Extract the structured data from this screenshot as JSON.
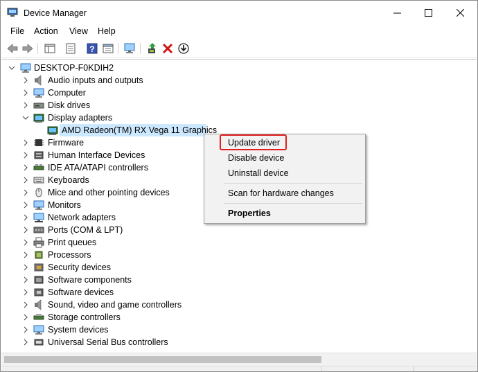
{
  "window": {
    "title": "Device Manager",
    "app_icon": "device-manager-icon"
  },
  "menu": [
    "File",
    "Action",
    "View",
    "Help"
  ],
  "toolbar": [
    "back-arrow-icon",
    "forward-arrow-icon",
    "show-hide-tree-icon",
    "properties-icon",
    "help-icon",
    "view-icon",
    "monitor-icon",
    "update-driver-icon",
    "uninstall-icon",
    "download-icon"
  ],
  "tree": {
    "root": "DESKTOP-F0KDIH2",
    "categories": [
      {
        "label": "Audio inputs and outputs",
        "icon": "speaker-icon",
        "expanded": false
      },
      {
        "label": "Computer",
        "icon": "computer-icon",
        "expanded": false
      },
      {
        "label": "Disk drives",
        "icon": "disk-drive-icon",
        "expanded": false
      },
      {
        "label": "Display adapters",
        "icon": "display-adapter-icon",
        "expanded": true,
        "children": [
          "AMD Radeon(TM) RX Vega 11 Graphics"
        ]
      },
      {
        "label": "Firmware",
        "icon": "firmware-icon",
        "expanded": false
      },
      {
        "label": "Human Interface Devices",
        "icon": "hid-icon",
        "expanded": false
      },
      {
        "label": "IDE ATA/ATAPI controllers",
        "icon": "ide-controller-icon",
        "expanded": false
      },
      {
        "label": "Keyboards",
        "icon": "keyboard-icon",
        "expanded": false
      },
      {
        "label": "Mice and other pointing devices",
        "icon": "mouse-icon",
        "expanded": false
      },
      {
        "label": "Monitors",
        "icon": "monitor-icon",
        "expanded": false
      },
      {
        "label": "Network adapters",
        "icon": "network-adapter-icon",
        "expanded": false
      },
      {
        "label": "Ports (COM & LPT)",
        "icon": "port-icon",
        "expanded": false
      },
      {
        "label": "Print queues",
        "icon": "printer-icon",
        "expanded": false
      },
      {
        "label": "Processors",
        "icon": "processor-icon",
        "expanded": false
      },
      {
        "label": "Security devices",
        "icon": "security-device-icon",
        "expanded": false
      },
      {
        "label": "Software components",
        "icon": "software-component-icon",
        "expanded": false
      },
      {
        "label": "Software devices",
        "icon": "software-device-icon",
        "expanded": false
      },
      {
        "label": "Sound, video and game controllers",
        "icon": "sound-controller-icon",
        "expanded": false
      },
      {
        "label": "Storage controllers",
        "icon": "storage-controller-icon",
        "expanded": false
      },
      {
        "label": "System devices",
        "icon": "system-device-icon",
        "expanded": false
      },
      {
        "label": "Universal Serial Bus controllers",
        "icon": "usb-controller-icon",
        "expanded": false
      }
    ]
  },
  "context_menu": {
    "items": [
      {
        "label": "Update driver",
        "highlighted": true
      },
      {
        "label": "Disable device"
      },
      {
        "label": "Uninstall device"
      },
      {
        "label": "Scan for hardware changes"
      },
      {
        "label": "Properties",
        "bold": true
      }
    ]
  },
  "colors": {
    "selection": "#cce8ff",
    "highlight_box": "#e02020",
    "help_blue": "#3a55b0",
    "uninstall_red": "#d41414"
  }
}
